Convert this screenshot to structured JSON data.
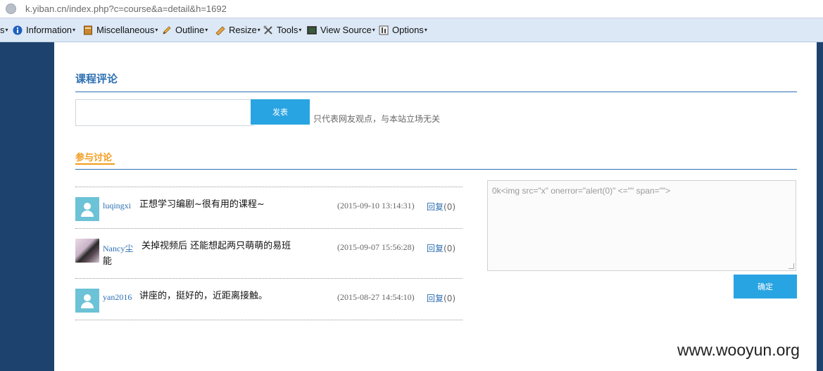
{
  "browser": {
    "url": "k.yiban.cn/index.php?c=course&a=detail&h=1692"
  },
  "toolbar": {
    "items": [
      {
        "label": "s",
        "icon": "none"
      },
      {
        "label": "Information",
        "icon": "info-icon"
      },
      {
        "label": "Miscellaneous",
        "icon": "book-icon"
      },
      {
        "label": "Outline",
        "icon": "pencil-icon"
      },
      {
        "label": "Resize",
        "icon": "ruler-icon"
      },
      {
        "label": "Tools",
        "icon": "tools-icon"
      },
      {
        "label": "View Source",
        "icon": "terminal-icon"
      },
      {
        "label": "Options",
        "icon": "options-icon"
      }
    ]
  },
  "review": {
    "title": "课程评论",
    "input_value": "",
    "submit_label": "发表",
    "note": "只代表网友观点，与本站立场无关"
  },
  "discussion": {
    "tab_label": "参与讨论",
    "comments": [
      {
        "user": "luqingxi",
        "text": "正想学习编剧~很有用的课程~",
        "date": "(2015-09-10 13:14:31)",
        "reply": "回复",
        "reply_count": "(0)",
        "avatar": "default"
      },
      {
        "user": "Nancy尘",
        "text": "关掉视频后 还能想起两只萌萌的易班",
        "text2": "能",
        "date": "(2015-09-07 15:56:28)",
        "reply": "回复",
        "reply_count": "(0)",
        "avatar": "photo"
      },
      {
        "user": "yan2016",
        "text": "讲座的，挺好的，近距离接触。",
        "date": "(2015-08-27 14:54:10)",
        "reply": "回复",
        "reply_count": "(0)",
        "avatar": "default"
      }
    ],
    "textarea_value": "0k<img src=\"x\" onerror=\"alert(0)\" <=\"\" span=\"\">",
    "confirm_label": "确定"
  },
  "watermark": "www.wooyun.org",
  "colors": {
    "page_band": "#1d426e",
    "accent_blue": "#2d6fb3",
    "button_blue": "#29a4e2",
    "accent_orange": "#f29b1a"
  }
}
